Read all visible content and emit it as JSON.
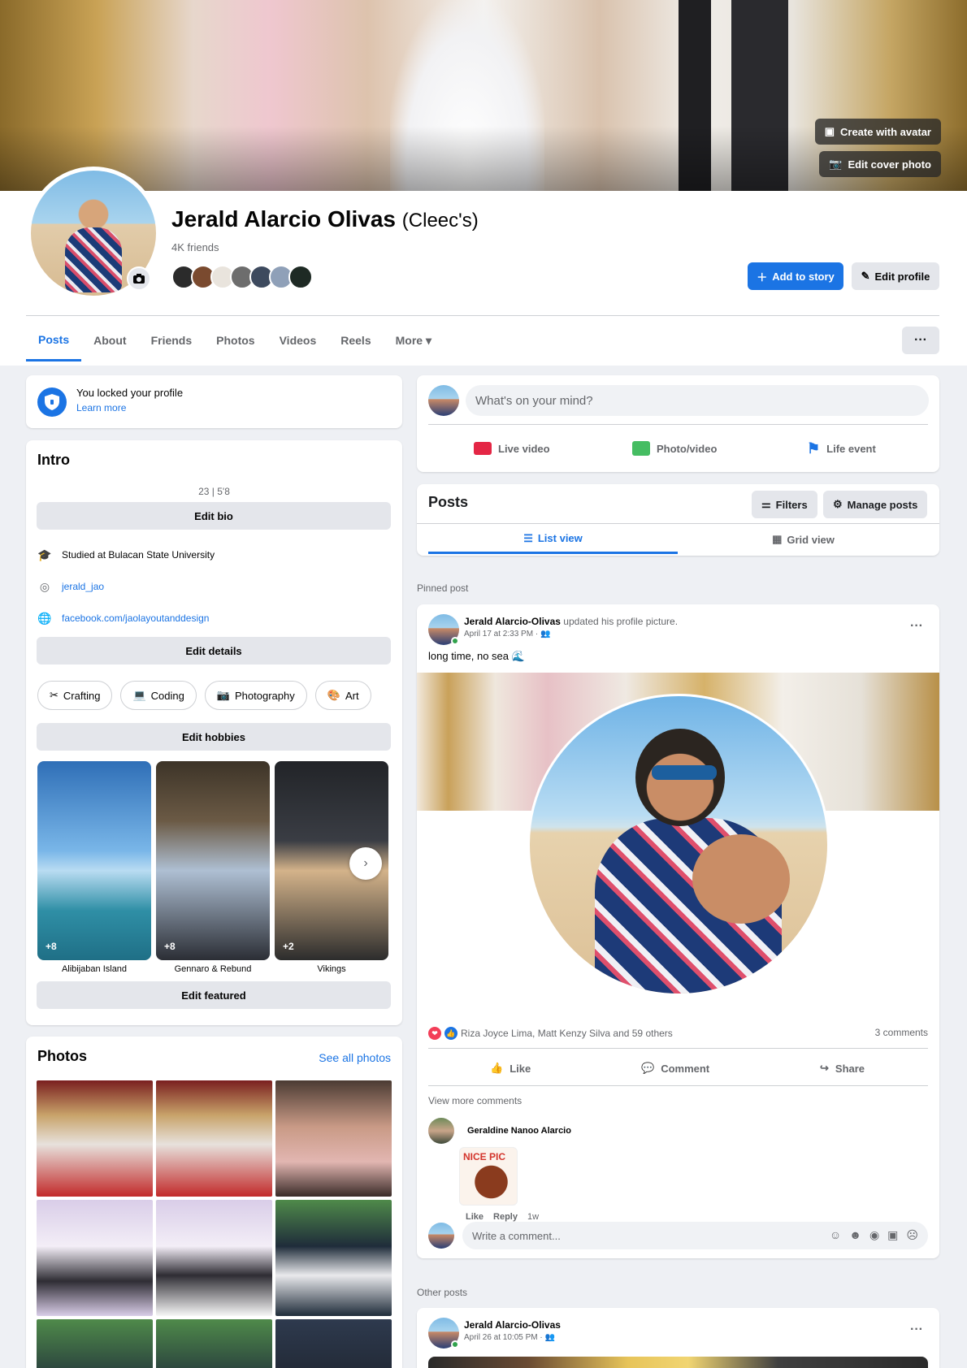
{
  "cover": {
    "create_avatar_label": "Create with avatar",
    "edit_cover_label": "Edit cover photo"
  },
  "profile": {
    "name": "Jerald Alarcio Olivas",
    "nickname": "(Cleec's)",
    "friends": "4K friends",
    "add_story": "Add to story",
    "edit_profile": "Edit profile"
  },
  "tabs": [
    "Posts",
    "About",
    "Friends",
    "Photos",
    "Videos",
    "Reels",
    "More ▾"
  ],
  "lock": {
    "title": "You locked your profile",
    "link": "Learn more"
  },
  "intro": {
    "title": "Intro",
    "bio": "23 | 5'8",
    "edit_bio": "Edit bio",
    "details": [
      {
        "icon": "graduation-cap-icon",
        "prefix": "Studied at ",
        "value": "Bulacan State University"
      },
      {
        "icon": "instagram-icon",
        "prefix": "",
        "value": "jerald_jao"
      },
      {
        "icon": "globe-icon",
        "prefix": "",
        "value": "facebook.com/jaolayoutanddesign"
      }
    ],
    "edit_details": "Edit details",
    "hobbies": [
      "Crafting",
      "Coding",
      "Photography",
      "Art"
    ],
    "edit_hobbies": "Edit hobbies",
    "featured": [
      {
        "label": "Alibijaban Island",
        "count": "+8"
      },
      {
        "label": "Gennaro & Rebund",
        "count": "+8"
      },
      {
        "label": "Vikings",
        "count": "+2"
      }
    ],
    "edit_featured": "Edit featured"
  },
  "photos": {
    "title": "Photos",
    "see_all": "See all photos"
  },
  "composer": {
    "placeholder": "What's on your mind?",
    "live": "Live video",
    "photo": "Photo/video",
    "life": "Life event"
  },
  "posts_bar": {
    "title": "Posts",
    "filters": "Filters",
    "manage": "Manage posts",
    "list_view": "List view",
    "grid_view": "Grid view"
  },
  "pinned": {
    "section": "Pinned post",
    "author": "Jerald Alarcio-Olivas",
    "action": "updated his profile picture.",
    "time": "April 17 at 2:33 PM · ",
    "text": "long time, no sea 🌊",
    "reactions": "Riza Joyce Lima, Matt Kenzy Silva and 59 others",
    "comments": "3 comments",
    "like": "Like",
    "comment": "Comment",
    "share": "Share",
    "view_more": "View more comments",
    "commenter": "Geraldine Nanoo Alarcio",
    "sticker_text": "NICE PIC",
    "c_like": "Like",
    "c_reply": "Reply",
    "c_time": "1w",
    "write_placeholder": "Write a comment..."
  },
  "other": {
    "section": "Other posts",
    "author": "Jerald Alarcio-Olivas",
    "time": "April 26 at 10:05 PM · "
  }
}
